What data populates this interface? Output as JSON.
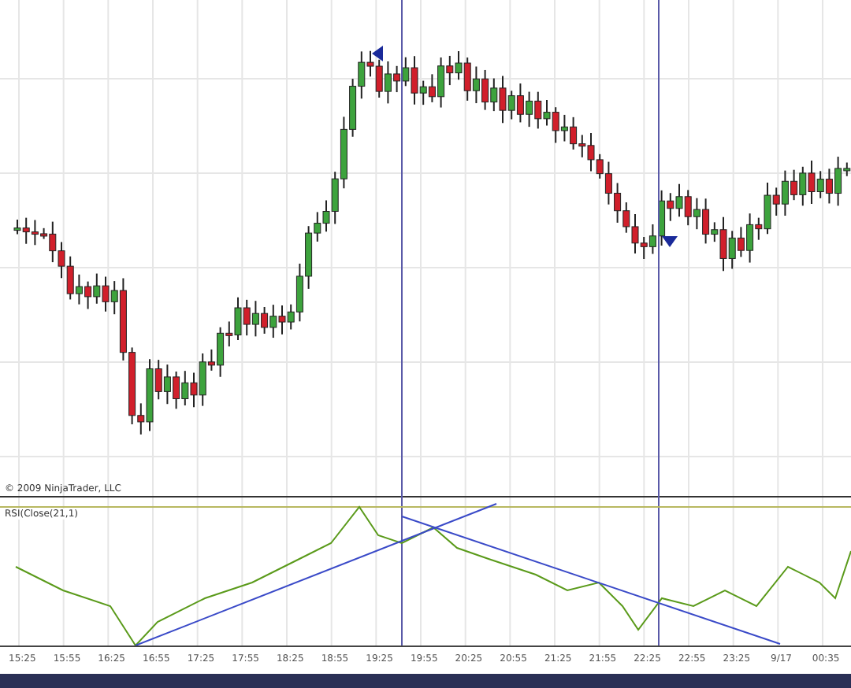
{
  "copyright": "© 2009 NinjaTrader, LLC",
  "indicator": {
    "label": "RSI(Close(21,1)"
  },
  "time_axis": {
    "labels": [
      "15:25",
      "15:55",
      "16:25",
      "16:55",
      "17:25",
      "17:55",
      "18:25",
      "18:55",
      "19:25",
      "19:55",
      "20:25",
      "20:55",
      "21:25",
      "21:55",
      "22:25",
      "22:55",
      "23:25",
      "9/17",
      "00:35"
    ]
  }
}
